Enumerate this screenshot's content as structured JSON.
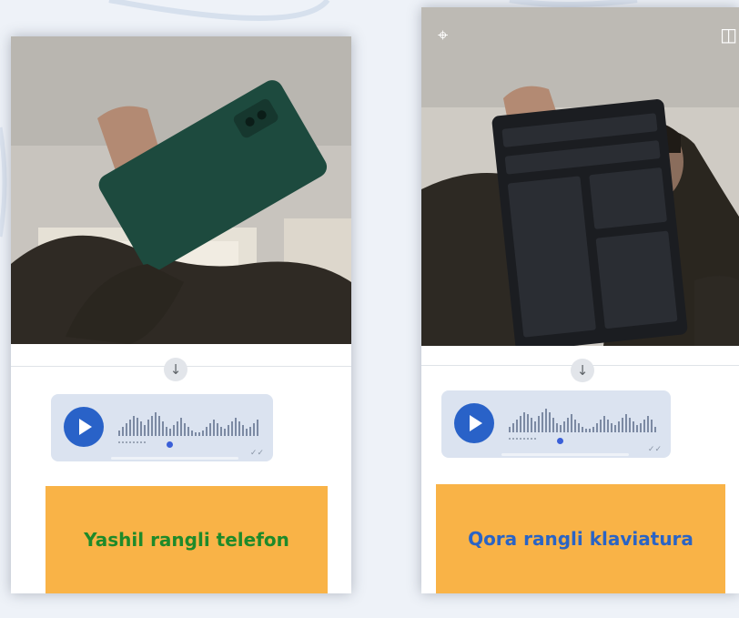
{
  "captions": {
    "left": "Yashil rangli telefon",
    "right": "Qora rangli klaviatura"
  },
  "icons": {
    "crop": "crop-icon",
    "compare": "compare-icon",
    "scroll_down": "arrow-down-icon",
    "play": "play-icon",
    "read_receipt": "double-check-icon"
  },
  "colors": {
    "caption_background": "#f9b347",
    "left_caption_text": "#1e8a2a",
    "right_caption_text": "#2a64c5",
    "play_button": "#2962c8",
    "voice_bubble": "#dbe3f0"
  }
}
